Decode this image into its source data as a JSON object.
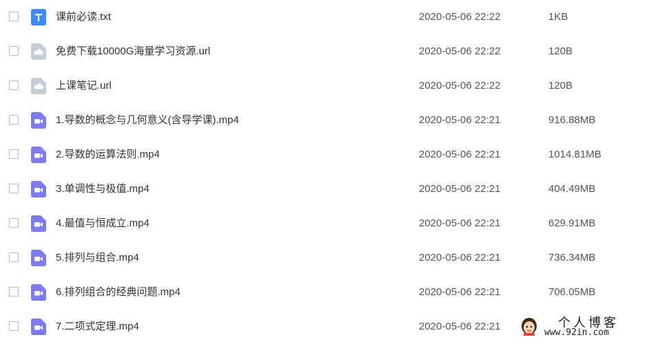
{
  "colors": {
    "txt_icon": "#3f8cf7",
    "url_icon": "#c5cdd8",
    "video_icon": "#7e7bf0"
  },
  "files": [
    {
      "name": "课前必读.txt",
      "date": "2020-05-06 22:22",
      "size": "1KB",
      "icon": "txt-file-icon"
    },
    {
      "name": "免费下载10000G海量学习资源.url",
      "date": "2020-05-06 22:22",
      "size": "120B",
      "icon": "link-file-icon"
    },
    {
      "name": "上课笔记.url",
      "date": "2020-05-06 22:22",
      "size": "120B",
      "icon": "link-file-icon"
    },
    {
      "name": "1.导数的概念与几何意义(含导学课).mp4",
      "date": "2020-05-06 22:21",
      "size": "916.88MB",
      "icon": "video-file-icon"
    },
    {
      "name": "2.导数的运算法则.mp4",
      "date": "2020-05-06 22:21",
      "size": "1014.81MB",
      "icon": "video-file-icon"
    },
    {
      "name": "3.单调性与极值.mp4",
      "date": "2020-05-06 22:21",
      "size": "404.49MB",
      "icon": "video-file-icon"
    },
    {
      "name": "4.最值与恒成立.mp4",
      "date": "2020-05-06 22:21",
      "size": "629.91MB",
      "icon": "video-file-icon"
    },
    {
      "name": "5.排列与组合.mp4",
      "date": "2020-05-06 22:21",
      "size": "736.34MB",
      "icon": "video-file-icon"
    },
    {
      "name": "6.排列组合的经典问题.mp4",
      "date": "2020-05-06 22:21",
      "size": "706.05MB",
      "icon": "video-file-icon"
    },
    {
      "name": "7.二项式定理.mp4",
      "date": "2020-05-06 22:21",
      "size": "",
      "icon": "video-file-icon"
    }
  ],
  "watermark": {
    "title": "个人博客",
    "url": "www.92in.com"
  }
}
